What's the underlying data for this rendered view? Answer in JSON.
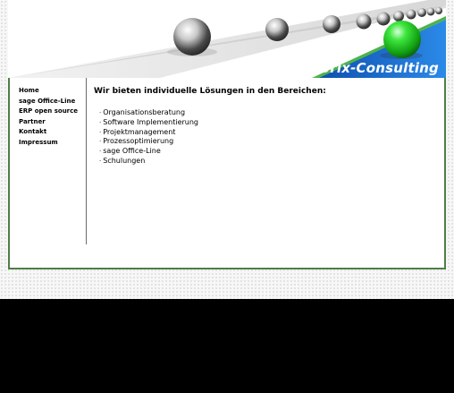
{
  "brand": {
    "name": "Brix-Consulting"
  },
  "colors": {
    "accent_green": "#4f7d47",
    "banner_blue": "#1a6fd6",
    "ball_green": "#2bd42b"
  },
  "nav": {
    "items": [
      {
        "label": "Home"
      },
      {
        "label": "sage Office-Line"
      },
      {
        "label": "ERP open source"
      },
      {
        "label": "Partner"
      },
      {
        "label": "Kontakt"
      },
      {
        "label": "Impressum"
      }
    ]
  },
  "main": {
    "heading": "Wir bieten individuelle Lösungen in den Bereichen:",
    "services": [
      "Organisationsberatung",
      "Software Implementierung",
      "Projektmanagement",
      "Prozessoptimierung",
      "sage Office-Line",
      "Schulungen"
    ]
  }
}
